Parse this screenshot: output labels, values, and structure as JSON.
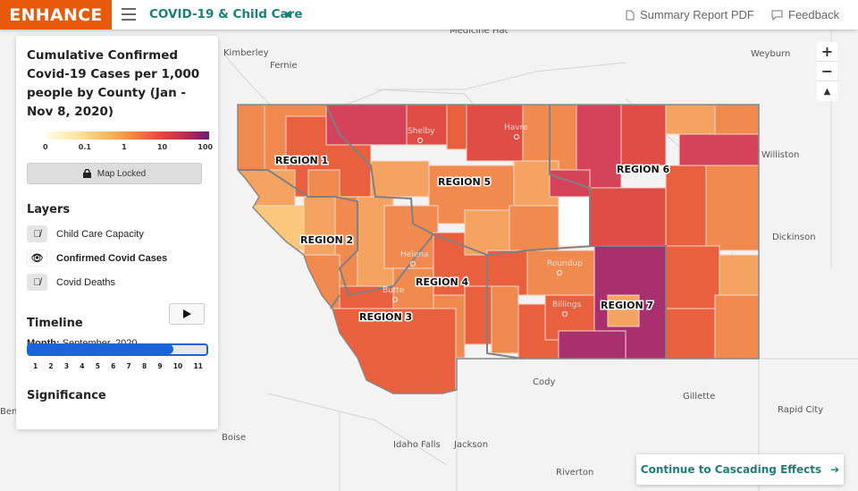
{
  "header": {
    "logo": "ENHANCE",
    "title": "COVID-19 & Child Care",
    "summary_link": "Summary Report PDF",
    "feedback_link": "Feedback"
  },
  "panel": {
    "title": "Cumulative Confirmed Covid-19 Cases per 1,000 people by County (Jan - Nov 8, 2020)",
    "legend_ticks": [
      "0",
      "0.1",
      "1",
      "10",
      "100"
    ],
    "legend_scale": "log",
    "legend_colors": [
      "#fffde8",
      "#fde49a",
      "#f8a24c",
      "#e8483a",
      "#b02a55",
      "#6b1a79"
    ],
    "map_locked": "Map Locked",
    "layers_heading": "Layers",
    "layers": [
      {
        "label": "Child Care Capacity",
        "visible": false
      },
      {
        "label": "Confirmed Covid Cases",
        "visible": true
      },
      {
        "label": "Covid Deaths",
        "visible": false
      }
    ],
    "timeline_heading": "Timeline",
    "month_label": "Month:",
    "month_value": "September, 2020",
    "slider_value": 9,
    "slider_ticks": [
      "1",
      "2",
      "3",
      "4",
      "5",
      "6",
      "7",
      "8",
      "9",
      "10",
      "11"
    ],
    "significance_heading": "Significance"
  },
  "map": {
    "regions": [
      "REGION 1",
      "REGION 2",
      "REGION 3",
      "REGION 4",
      "REGION 5",
      "REGION 6",
      "REGION 7"
    ],
    "cities": [
      "Kimberley",
      "Fernie",
      "Medicine Hat",
      "Weyburn",
      "Williston",
      "Dickinson",
      "Rapid City",
      "Gillette",
      "Cody",
      "Boise",
      "Idaho Falls",
      "Jackson",
      "Riverton",
      "Ben"
    ],
    "state_cities": [
      "Shelby",
      "Havre",
      "Helena",
      "Butte",
      "Billings",
      "Roundup"
    ],
    "zoom_in": "+",
    "zoom_out": "−"
  },
  "cta": {
    "label": "Continue to Cascading Effects"
  }
}
